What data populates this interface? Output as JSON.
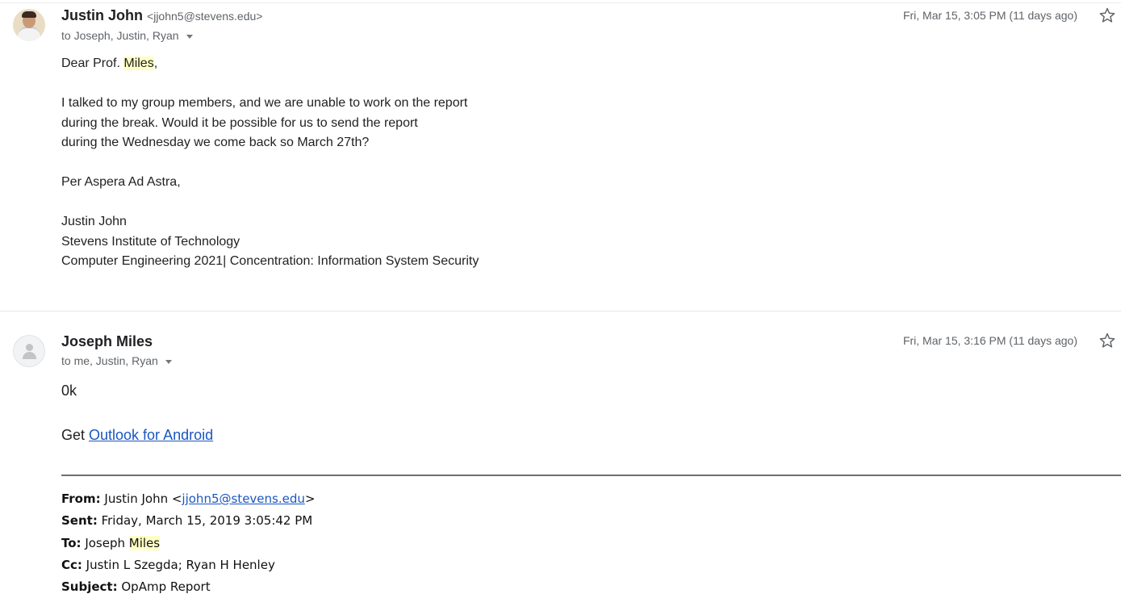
{
  "message1": {
    "sender_name": "Justin John",
    "sender_email": "<jjohn5@stevens.edu>",
    "recipients": "to Joseph, Justin, Ryan",
    "date": "Fri, Mar 15, 3:05 PM (11 days ago)",
    "greeting_prefix": "Dear Prof. ",
    "greeting_name": "Miles",
    "greeting_suffix": ",",
    "para_1": "I talked to my group members, and we are unable to work on the report",
    "para_2": "during the break. Would it be possible for us to send the report",
    "para_3": "during the Wednesday we come back so March 27th?",
    "closing": "Per Aspera Ad Astra,",
    "sig_name": "Justin John",
    "sig_school": "Stevens Institute of Technology",
    "sig_major": "Computer Engineering 2021| Concentration: Information System Security"
  },
  "message2": {
    "sender_name": "Joseph Miles",
    "recipients": "to me, Justin, Ryan",
    "date": "Fri, Mar 15, 3:16 PM (11 days ago)",
    "reply": "0k",
    "get_prefix": "Get ",
    "outlook_link": "Outlook for Android",
    "quoted": {
      "from_label": "From:",
      "from_name": " Justin John <",
      "from_email": "jjohn5@stevens.edu",
      "from_close": ">",
      "sent_label": "Sent:",
      "sent_value": " Friday, March 15, 2019 3:05:42 PM",
      "to_label": "To:",
      "to_value": " Joseph ",
      "to_highlight": "Miles",
      "cc_label": "Cc:",
      "cc_value": " Justin L Szegda; Ryan H Henley",
      "subject_label": "Subject:",
      "subject_value": " OpAmp Report"
    }
  },
  "colors": {
    "highlight": "#ffffc6",
    "link": "#1a57c0",
    "meta_text": "#5f6368"
  },
  "icons": {
    "star": "star-icon",
    "caret": "caret-down-icon"
  }
}
